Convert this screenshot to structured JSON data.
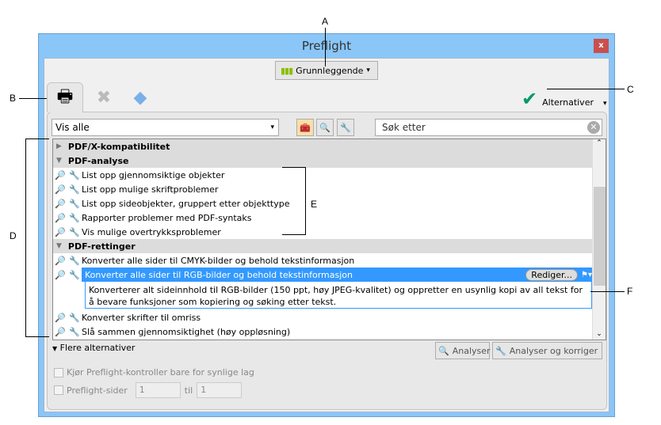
{
  "window": {
    "title": "Preflight",
    "close": "x"
  },
  "profile_button": {
    "label": "Grunnleggende",
    "caret": "▾"
  },
  "tabs": [
    {
      "icon": "profiles-print-magnifier-icon"
    },
    {
      "icon": "results-tools-icon"
    },
    {
      "icon": "standards-diamond-icon"
    }
  ],
  "options": {
    "label": "Alternativer",
    "caret": "▾"
  },
  "filter": {
    "value": "Vis alle",
    "caret": "▾"
  },
  "search": {
    "placeholder": "Søk etter"
  },
  "list": {
    "groups": [
      {
        "label": "PDF/X-kompatibilitet",
        "expanded": false,
        "items": []
      },
      {
        "label": "PDF-analyse",
        "expanded": true,
        "items": [
          "List opp gjennomsiktige objekter",
          "List opp mulige skriftproblemer",
          "List opp sideobjekter, gruppert etter objekttype",
          "Rapporter problemer med PDF-syntaks",
          "Vis mulige overtrykksproblemer"
        ]
      },
      {
        "label": "PDF-rettinger",
        "expanded": true,
        "items": [
          "Konverter alle sider til CMYK-bilder og behold tekstinformasjon",
          "Konverter alle sider til RGB-bilder og behold tekstinformasjon",
          "Konverter skrifter til omriss",
          "Slå sammen gjennomsiktighet (høy oppløsning)"
        ]
      }
    ],
    "selected_edit": "Rediger...",
    "selected_description": "Konverterer alt sideinnhold til RGB-bilder (150 ppt, høy JPEG-kvalitet) og oppretter en usynlig kopi av all tekst for å bevare funksjoner som kopiering og søking etter tekst."
  },
  "more_options": "Flere alternativer",
  "analyze": "Analyser",
  "analyze_fix": "Analyser og korriger",
  "visible_layers": "Kjør Preflight-kontroller bare for synlige lag",
  "pages": {
    "label": "Preflight-sider",
    "from": "1",
    "to_label": "til",
    "to": "1"
  },
  "annotations": {
    "a": "A",
    "b": "B",
    "c": "C",
    "d": "D",
    "e": "E",
    "f": "F"
  },
  "colors": {
    "accent": "#3399ff",
    "titlebar": "#8ac6f8",
    "close": "#c9504d",
    "check": "#009966"
  }
}
